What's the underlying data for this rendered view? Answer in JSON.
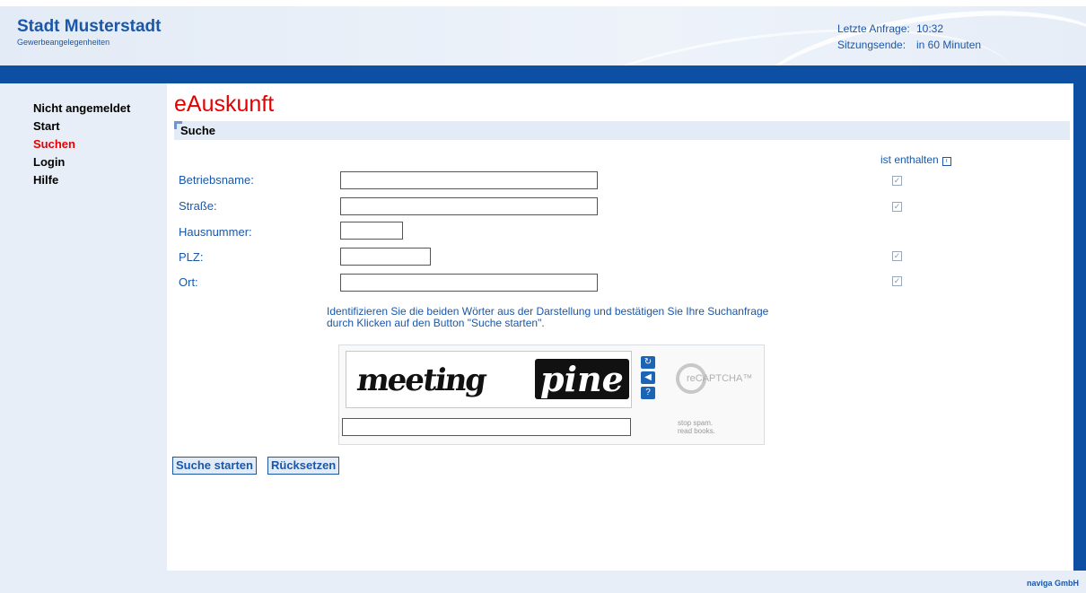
{
  "header": {
    "title": "Stadt Musterstadt",
    "subtitle": "Gewerbeangelegenheiten",
    "last_request_label": "Letzte Anfrage:",
    "last_request_value": "10:32",
    "session_end_label": "Sitzungsende:",
    "session_end_value": "in 60 Minuten"
  },
  "sidebar": {
    "items": [
      {
        "label": "Nicht angemeldet"
      },
      {
        "label": "Start"
      },
      {
        "label": "Suchen"
      },
      {
        "label": "Login"
      },
      {
        "label": "Hilfe"
      }
    ]
  },
  "main": {
    "page_title": "eAuskunft",
    "section_title": "Suche",
    "contains_label": "ist enthalten",
    "fields": [
      {
        "label": "Betriebsname:",
        "value": "",
        "contains_checked": true
      },
      {
        "label": "Straße:",
        "value": "",
        "contains_checked": true
      },
      {
        "label": "Hausnummer:",
        "value": ""
      },
      {
        "label": "PLZ:",
        "value": "",
        "contains_checked": true
      },
      {
        "label": "Ort:",
        "value": "",
        "contains_checked": true
      }
    ],
    "captcha_instructions": "Identifizieren Sie die beiden Wörter aus der Darstellung und bestätigen Sie Ihre Suchanfrage durch Klicken auf den Button \"Suche starten\".",
    "captcha": {
      "word1": "meeting",
      "word2": "pine",
      "brand": "reCAPTCHA™",
      "tagline_1": "stop spam.",
      "tagline_2": "read books.",
      "input_value": ""
    },
    "buttons": {
      "search": "Suche starten",
      "reset": "Rücksetzen"
    }
  },
  "footer": {
    "text": "naviga GmbH"
  },
  "colors": {
    "brand_blue": "#0d4fa3",
    "accent_red": "#e60000",
    "text_blue": "#1a57a8"
  }
}
